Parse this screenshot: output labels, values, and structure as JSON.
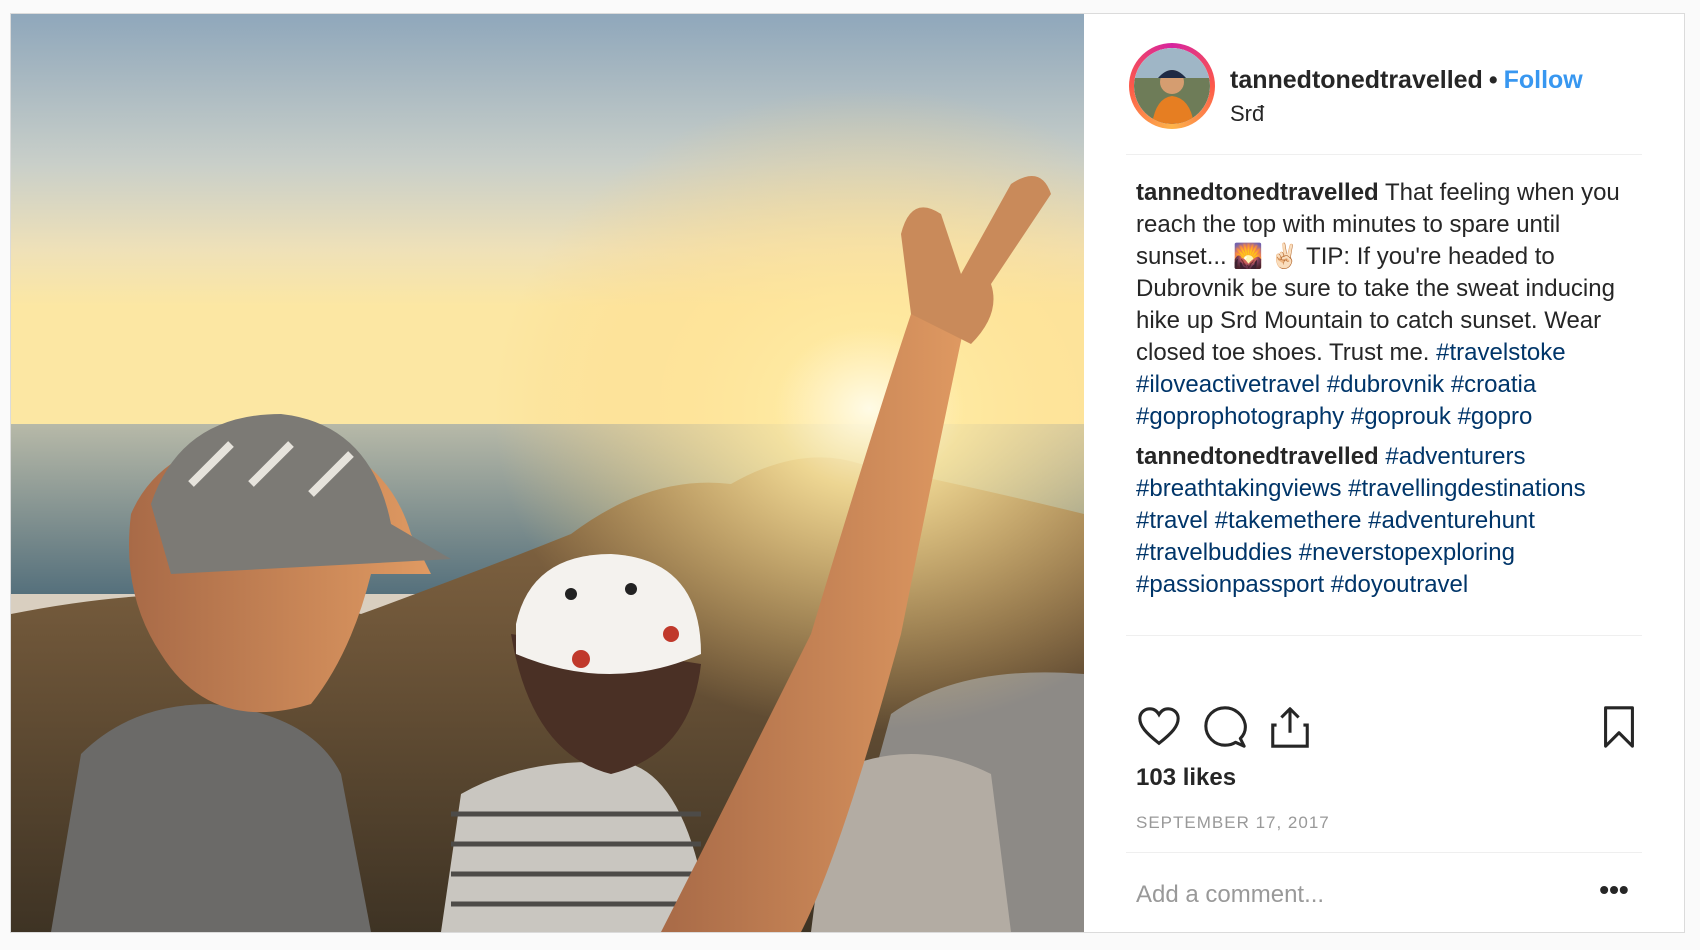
{
  "post": {
    "username": "tannedtonedtravelled",
    "separator": "•",
    "follow_label": "Follow",
    "location": "Srđ",
    "comments": [
      {
        "username": "tannedtonedtravelled",
        "text": "That feeling when you reach the top with minutes to spare until sunset... 🌄 ✌🏻 TIP: If you're headed to Dubrovnik be sure to take the sweat inducing hike up Srd Mountain to catch sunset. Wear closed toe shoes. Trust me.",
        "hashtags": "#travelstoke #iloveactivetravel #dubrovnik #croatia #goprophotography #goprouk #gopro"
      },
      {
        "username": "tannedtonedtravelled",
        "text": "",
        "hashtags": "#adventurers #breathtakingviews #travellingdestinations #travel #takemethere #adventurehunt #travelbuddies #neverstopexploring #passionpassport #doyoutravel"
      }
    ],
    "likes": "103 likes",
    "date": "SEPTEMBER 17, 2017",
    "comment_placeholder": "Add a comment...",
    "more_label": "•••"
  },
  "icons": {
    "like": "heart-icon",
    "comment": "comment-bubble-icon",
    "share": "share-icon",
    "save": "bookmark-icon",
    "more": "ellipsis-icon"
  },
  "colors": {
    "follow": "#3897f0",
    "hashtag": "#003569",
    "muted": "#999999",
    "text": "#262626"
  }
}
